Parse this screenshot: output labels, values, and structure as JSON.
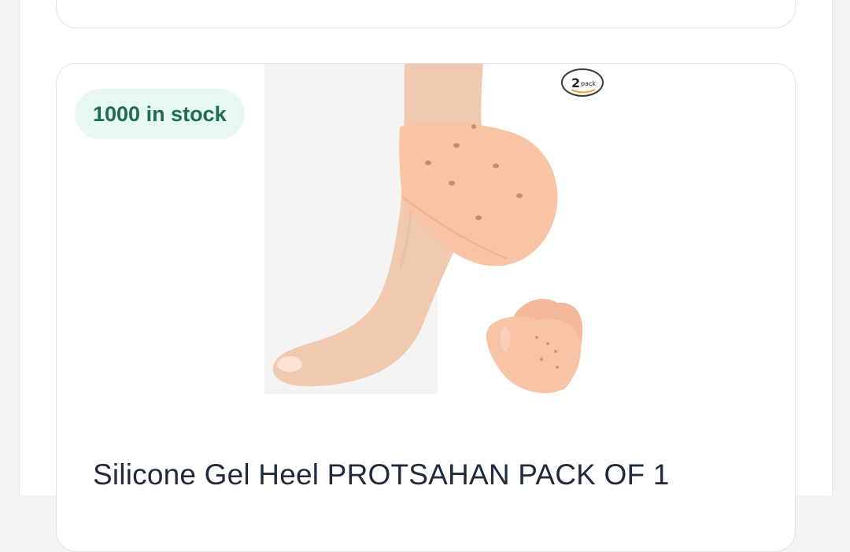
{
  "product": {
    "stock_label": "1000 in stock",
    "title": "Silicone Gel Heel PROTSAHAN PACK OF 1",
    "image_badge": {
      "number": "2",
      "text": "pack"
    }
  },
  "colors": {
    "stock_badge_bg": "#e7f8f0",
    "stock_badge_text": "#1d6d55",
    "title_text": "#1f2a3c",
    "card_border": "#e2e2e7",
    "skin": "#f1c9b0",
    "silicone": "#f7c4a6"
  }
}
